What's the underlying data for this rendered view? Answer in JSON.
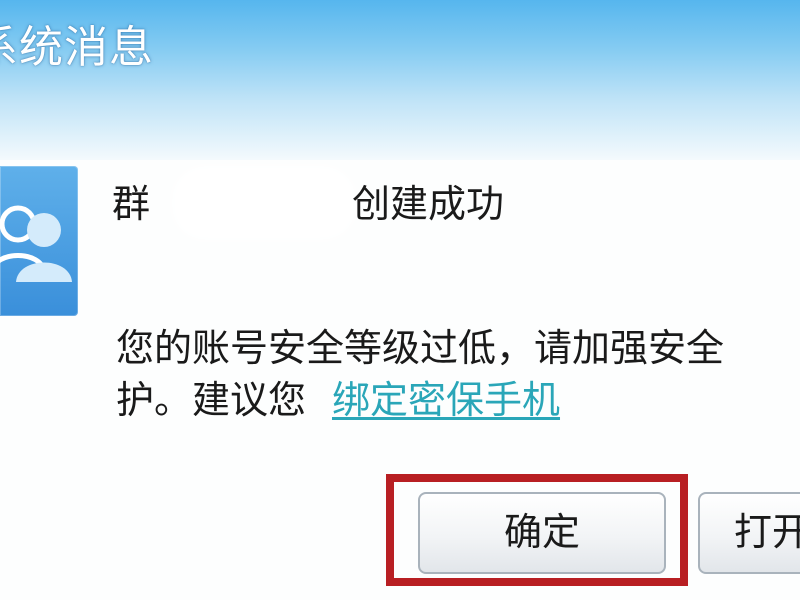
{
  "dialog": {
    "title": "系统消息",
    "group_prefix": "群",
    "group_suffix": "创建成功",
    "warning": "您的账号安全等级过低，请加强安全",
    "suggest_prefix": "护。建议您",
    "bind_link": "绑定密保手机",
    "avatar_icon": "group-icon"
  },
  "buttons": {
    "ok": "确定",
    "open": "打开"
  },
  "colors": {
    "title_bar_top": "#56b6ee",
    "title_bar_bottom": "#f4fafd",
    "avatar_bg": "#3a8fda",
    "link": "#2aa6b8",
    "highlight_frame": "#b81f23"
  }
}
